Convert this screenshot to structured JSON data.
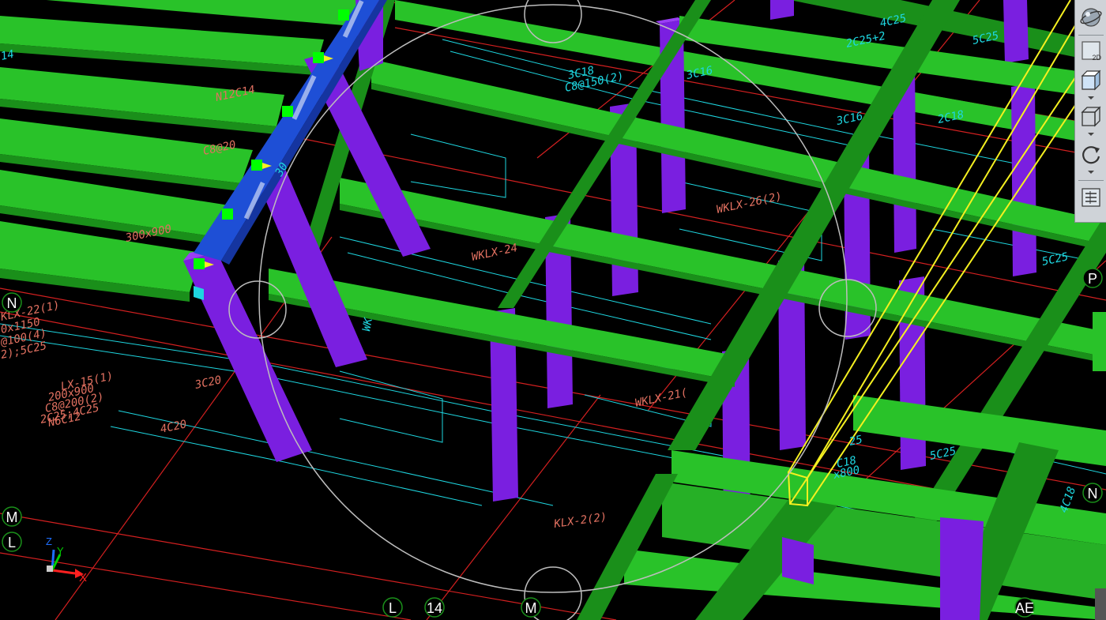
{
  "colors": {
    "background": "#000000",
    "beam_green": "#29c229",
    "beam_green_dark": "#1a8f1a",
    "column_purple": "#7a1fe0",
    "column_purple_light": "#9a3ff5",
    "selected_blue": "#1e4fd6",
    "grid_red": "#d42020",
    "rebar_cyan": "#1ed6e0",
    "text_salmon": "#e07060",
    "highlight_yellow": "#f5f020",
    "orbit_gray": "#bdbdbd",
    "grip_green": "#00ff00"
  },
  "axis_labels": {
    "left_n": "N",
    "left_m": "M",
    "left_l": "L",
    "right_p": "P",
    "right_n": "N",
    "bottom_l": "L",
    "bottom_14": "14",
    "bottom_m": "M",
    "bottom_ae": "AE"
  },
  "annotations": {
    "t1": "WKLX-26(2)",
    "t2": "WKLX-24",
    "t3": "WKLX-21(",
    "t4": "KLX-2(2)",
    "t5": "KLX-22(1)",
    "t6": "0x1150",
    "t7": "@100(4)",
    "t8": "2);5C25",
    "t9": "LX-15(1)",
    "t10": "200x900",
    "t11": "C8@200(2)",
    "t12": "2C25;4C25",
    "t13": "N6C12",
    "t14": "4C20",
    "t15": "3C20",
    "t16": "300x900",
    "t17": "N12C14",
    "t18": "C8@20",
    "t19": "3C18",
    "t20": "C8@150(2)",
    "t21": "3C16",
    "t22": "3C16",
    "t23": "4C25",
    "t24": "2C25+2",
    "t25": "5C25",
    "t26": "2C18",
    "t27": "5C25",
    "t28": "5C25",
    "t29": "C18",
    "t30": "x800",
    "t31": "4C18",
    "t32": "25",
    "t33": "14",
    "t34": "30",
    "t35": "WK"
  },
  "ucs": {
    "z": "Z",
    "y": "Y",
    "x": "X"
  },
  "toolbar": {
    "orbit_icon": "orbit-icon",
    "view_2d_label": "2D",
    "perspective_icon": "perspective-box-icon",
    "box_icon": "wireframe-box-icon",
    "rotate_icon": "rotate-icon",
    "properties_icon": "properties-panel-icon"
  }
}
